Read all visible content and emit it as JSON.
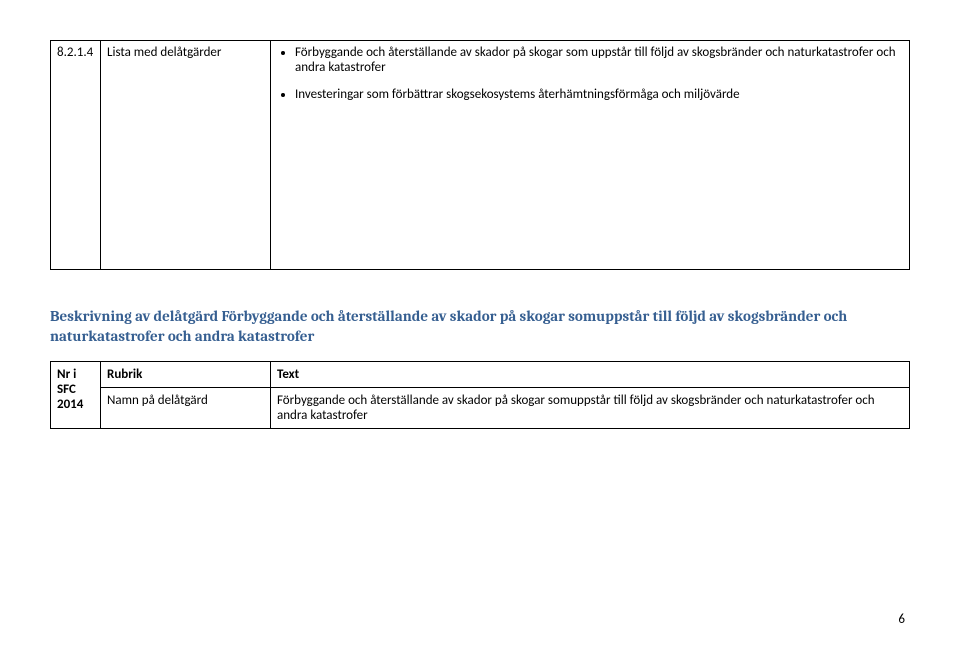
{
  "table1": {
    "ref": "8.2.1.4",
    "label": "Lista med delåtgärder",
    "bullet1": "Förbyggande och återställande av skador på skogar som uppstår till följd av skogsbränder och naturkatastrofer och andra katastrofer",
    "bullet2": "Investeringar som förbättrar skogsekosystems återhämtningsförmåga och miljövärde"
  },
  "heading": "Beskrivning av delåtgärd Förbyggande och återställande av skador på skogar somuppstår till följd av skogsbränder och naturkatastrofer och andra katastrofer",
  "table2": {
    "header_col1": "Nr i SFC 2014",
    "header_col2": "Rubrik",
    "header_col3": "Text",
    "row1_col2": "Namn på delåtgärd",
    "row1_col3": "Förbyggande och återställande av skador på skogar somuppstår till följd av skogsbränder och naturkatastrofer och andra katastrofer"
  },
  "page_number": "6"
}
